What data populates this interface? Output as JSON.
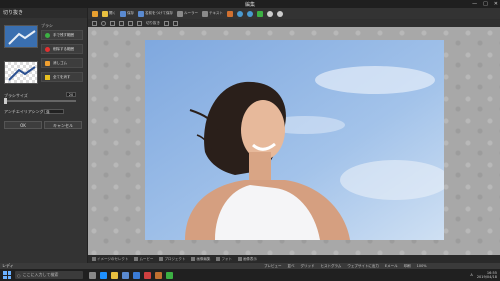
{
  "window": {
    "title": "編集",
    "controls": [
      "—",
      "□",
      "✕"
    ]
  },
  "left_panel": {
    "title": "切り抜き",
    "tool_group_label": "ブラシ",
    "tools": [
      {
        "label": "手で残す範囲",
        "color": "#3cb043"
      },
      {
        "label": "削除する範囲",
        "color": "#e03030"
      },
      {
        "label": "消しゴム",
        "color": "#f0a030"
      },
      {
        "label": "全てを消す",
        "color": "#e8c020"
      }
    ],
    "brush_size_label": "ブラシサイズ",
    "brush_size_value": "20",
    "antialias_label": "アンチエイリアシング",
    "antialias_value": "強",
    "ok_label": "OK",
    "cancel_label": "キャンセル"
  },
  "toolbar": {
    "items": [
      {
        "icon": "undo-arrow-icon",
        "label": "",
        "color": "#e8a030"
      },
      {
        "icon": "folder-icon",
        "label": "開く",
        "color": "#e8c040"
      },
      {
        "icon": "save-icon",
        "label": "保存",
        "color": "#5a8ad0"
      },
      {
        "icon": "save-as-icon",
        "label": "名前をつけて保存",
        "color": "#5a8ad0"
      },
      {
        "icon": "undo-icon",
        "label": "ルーラー",
        "color": "#8a8a8a"
      },
      {
        "icon": "text-icon",
        "label": "テキスト",
        "color": "#8a8a8a"
      },
      {
        "icon": "crop-icon",
        "label": "",
        "color": "#d07030"
      },
      {
        "icon": "rotate-left-icon",
        "label": "",
        "color": "#4a9ad0"
      },
      {
        "icon": "rotate-right-icon",
        "label": "",
        "color": "#4a9ad0"
      },
      {
        "icon": "flip-icon",
        "label": "",
        "color": "#3cb043"
      },
      {
        "icon": "zoom-in-icon",
        "label": "",
        "color": "#cccccc"
      },
      {
        "icon": "zoom-out-icon",
        "label": "",
        "color": "#cccccc"
      }
    ],
    "sub_label": "切り抜き"
  },
  "bottom_tabs": [
    "イメージのセレクト",
    "ムービー",
    "プロジェクト",
    "画像編集",
    "フォト",
    "画像表示"
  ],
  "status": {
    "left": "レディ",
    "items": [
      "プレビュー",
      "並べ",
      "グリッド",
      "ヒストグラム",
      "ウェブサイトに出力",
      "Eメール",
      "印刷",
      "100%"
    ]
  },
  "taskbar": {
    "search_placeholder": "ここに入力して検索",
    "apps": [
      {
        "icon": "task-view-icon",
        "color": "#888888"
      },
      {
        "icon": "edge-icon",
        "color": "#1e90ff"
      },
      {
        "icon": "explorer-icon",
        "color": "#e8c040"
      },
      {
        "icon": "store-icon",
        "color": "#5a8ad0"
      },
      {
        "icon": "mail-icon",
        "color": "#3a7bd5"
      },
      {
        "icon": "photos-icon",
        "color": "#d04040"
      },
      {
        "icon": "app-icon",
        "color": "#c07030"
      },
      {
        "icon": "app2-icon",
        "color": "#3cb043"
      }
    ],
    "tray_ime": "A",
    "time": "16:55",
    "date": "2019/04/18"
  }
}
